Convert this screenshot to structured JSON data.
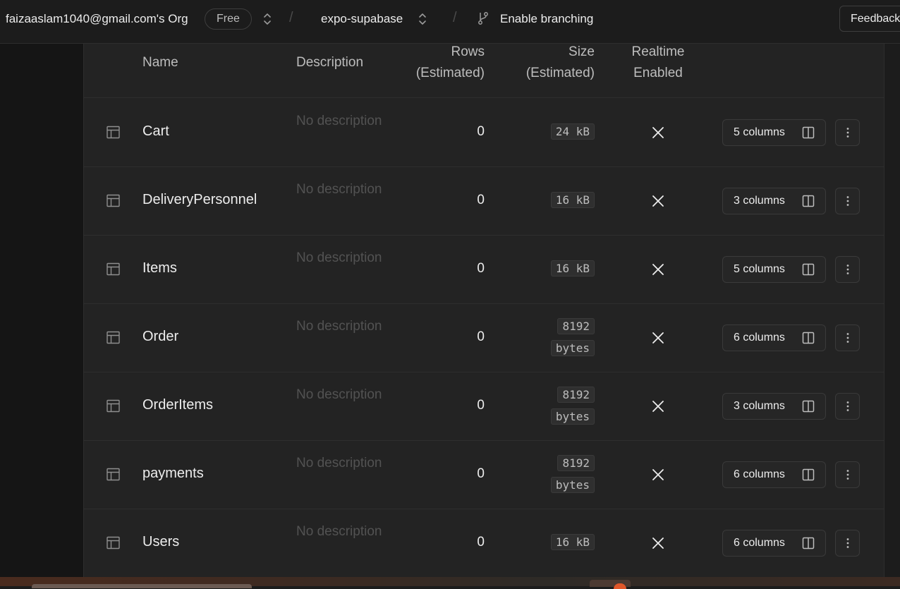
{
  "topbar": {
    "org_name": "faizaaslam1040@gmail.com's Org",
    "plan": "Free",
    "separator": "/",
    "project_name": "expo-supabase",
    "branching_label": "Enable branching",
    "feedback_label": "Feedback"
  },
  "table_header": {
    "name": "Name",
    "description": "Description",
    "rows_line1": "Rows",
    "rows_line2": "(Estimated)",
    "size_line1": "Size",
    "size_line2": "(Estimated)",
    "realtime_line1": "Realtime",
    "realtime_line2": "Enabled"
  },
  "tables": [
    {
      "name": "Cart",
      "description": "No description",
      "rows": "0",
      "size": "24 kB",
      "columns": "5 columns"
    },
    {
      "name": "DeliveryPersonnel",
      "description": "No description",
      "rows": "0",
      "size": "16 kB",
      "columns": "3 columns"
    },
    {
      "name": "Items",
      "description": "No description",
      "rows": "0",
      "size": "16 kB",
      "columns": "5 columns"
    },
    {
      "name": "Order",
      "description": "No description",
      "rows": "0",
      "size": "8192 bytes",
      "columns": "6 columns"
    },
    {
      "name": "OrderItems",
      "description": "No description",
      "rows": "0",
      "size": "8192 bytes",
      "columns": "3 columns"
    },
    {
      "name": "payments",
      "description": "No description",
      "rows": "0",
      "size": "8192 bytes",
      "columns": "6 columns"
    },
    {
      "name": "Users",
      "description": "No description",
      "rows": "0",
      "size": "16 kB",
      "columns": "6 columns"
    }
  ],
  "icons": {
    "row_icon": "table-icon",
    "realtime_disabled": "x-icon",
    "columns_button": "columns-icon",
    "more_button": "more-vertical-icon"
  },
  "colors": {
    "background": "#1c1c1c",
    "panel": "#232323",
    "muted_text": "#525252"
  }
}
